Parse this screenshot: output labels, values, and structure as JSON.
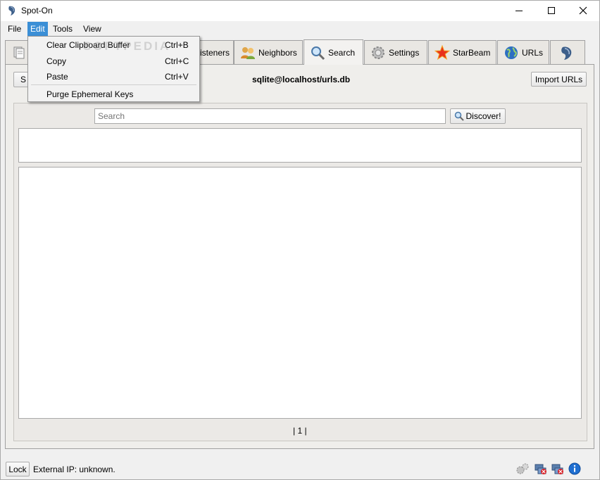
{
  "window": {
    "title": "Spot-On"
  },
  "menu": {
    "file": "File",
    "edit": "Edit",
    "tools": "Tools",
    "view": "View"
  },
  "edit_menu": {
    "items": [
      {
        "label": "Clear Clipboard Buffer",
        "shortcut": "Ctrl+B"
      },
      {
        "label": "Copy",
        "shortcut": "Ctrl+C"
      },
      {
        "label": "Paste",
        "shortcut": "Ctrl+V"
      },
      {
        "label": "Purge Ephemeral Keys",
        "shortcut": ""
      }
    ]
  },
  "tabs": [
    {
      "label": "",
      "icon": "documents-icon"
    },
    {
      "label": "isteners",
      "icon": ""
    },
    {
      "label": "Neighbors",
      "icon": "neighbors-icon"
    },
    {
      "label": "Search",
      "icon": "magnifier-icon",
      "active": true
    },
    {
      "label": "Settings",
      "icon": "gear-icon"
    },
    {
      "label": "StarBeam",
      "icon": "star-icon"
    },
    {
      "label": "URLs",
      "icon": "globe-icon"
    },
    {
      "label": "",
      "icon": "spot-on-logo-icon"
    }
  ],
  "search_tab": {
    "db_path": "sqlite@localhost/urls.db",
    "import_button": "Import URLs",
    "left_button": "S",
    "search_placeholder": "Search",
    "discover_button": "Discover!",
    "pagination": "| 1 |"
  },
  "statusbar": {
    "lock_button": "Lock",
    "external_ip": "External IP: unknown."
  },
  "watermark": "SOFTPEDIA",
  "colors": {
    "accent": "#3b8fd6",
    "star": "#e8311c",
    "globe": "#2d6fc2"
  }
}
